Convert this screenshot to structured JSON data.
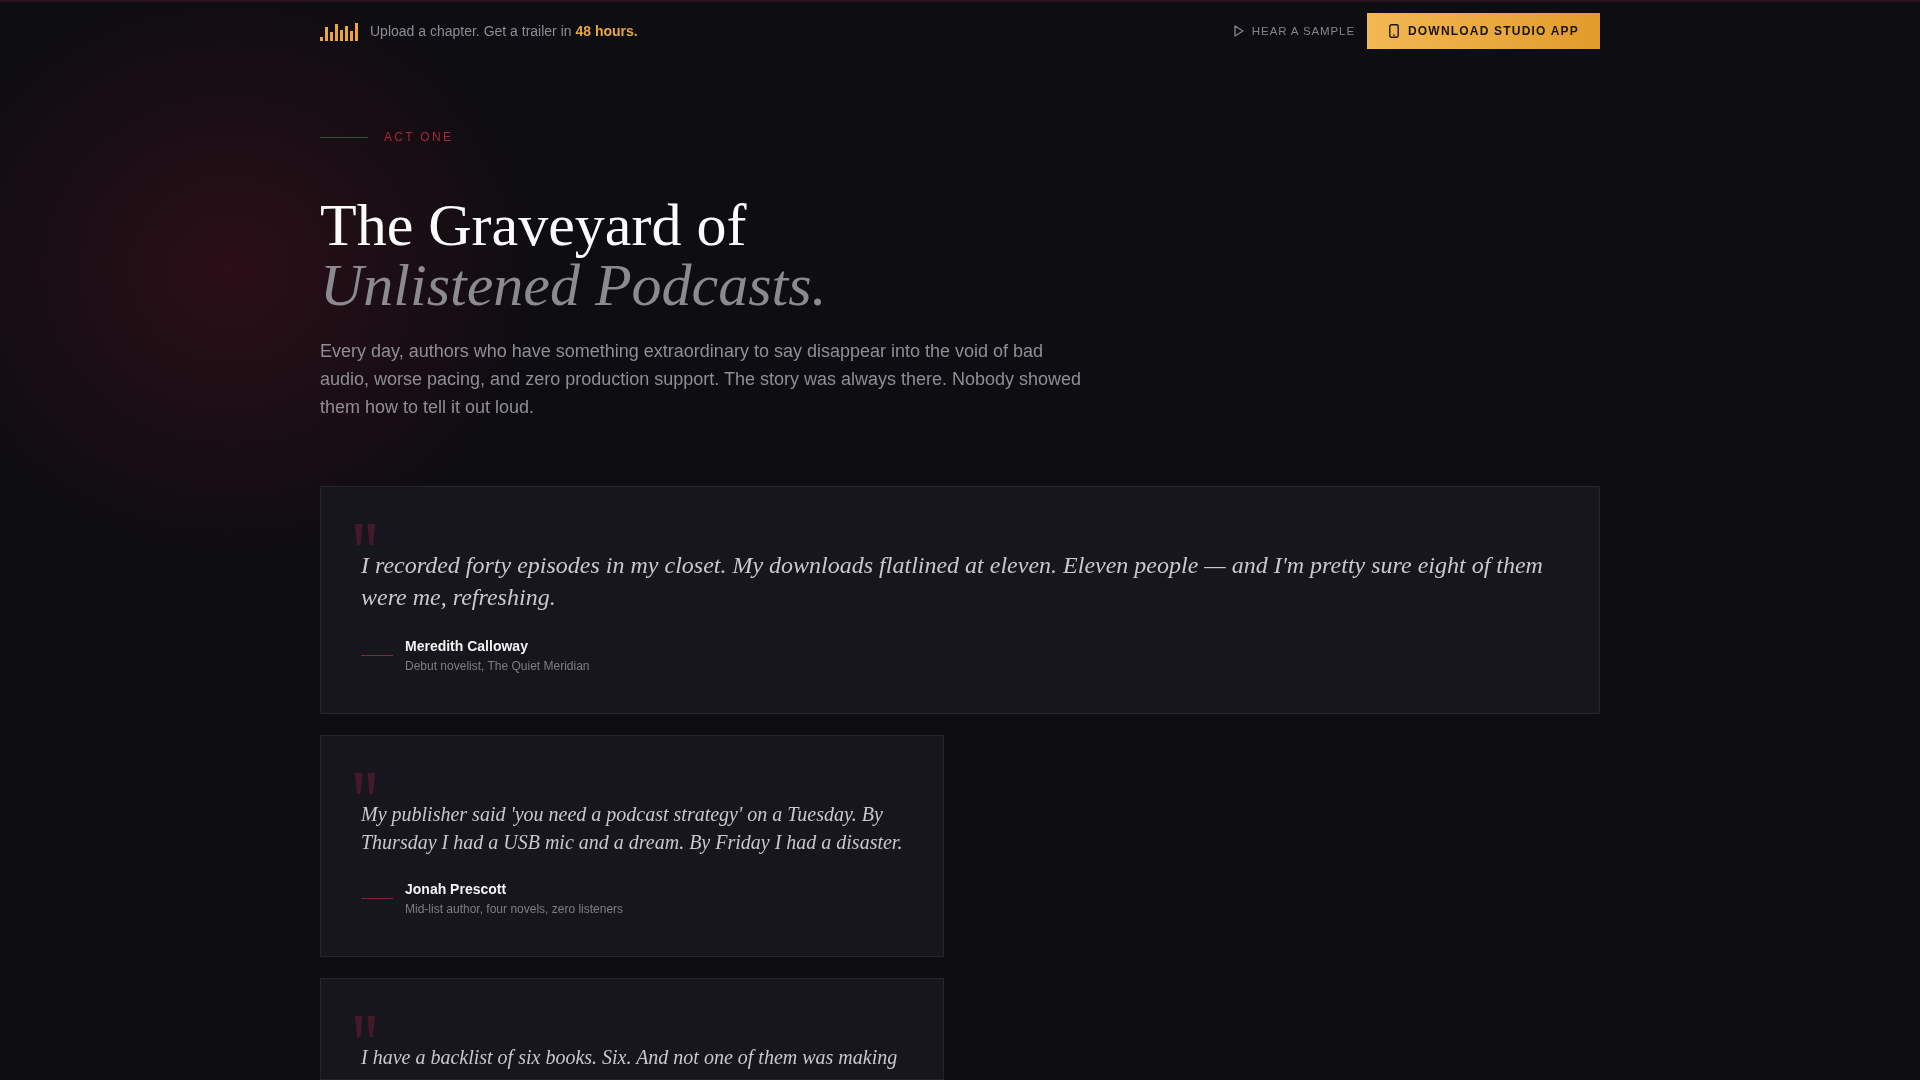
{
  "top_bar": {
    "tagline": "Upload a chapter. Get a trailer in **48 hours.**",
    "sample_link": "HEAR A SAMPLE",
    "download_button": "DOWNLOAD STUDIO APP"
  },
  "hero": {
    "eyebrow": "ACT ONE",
    "title_line_1": "The Graveyard of",
    "title_line_2": "Unlistened Podcasts.",
    "body": "Every day, authors who have something extraordinary to say disappear into the void of bad audio, worse pacing, and zero production support. The story was always there. Nobody showed them how to tell it out loud."
  },
  "testimonials": [
    {
      "kind": "featured",
      "quote": "I recorded forty episodes in my closet. My downloads flatlined at eleven. Eleven people — and I'm pretty sure eight of them were me, refreshing.",
      "name": "Meredith Calloway",
      "role": "Debut novelist, The Quiet Meridian"
    },
    {
      "kind": "standard",
      "quote": "My publisher said 'you need a podcast strategy' on a Tuesday. By Thursday I had a USB mic and a dream. By Friday I had a disaster.",
      "name": "Jonah Prescott",
      "role": "Mid-list author, four novels, zero listeners"
    },
    {
      "kind": "standard",
      "quote": "I have a backlist of six books. Six. And not one of them was making"
    }
  ]
}
